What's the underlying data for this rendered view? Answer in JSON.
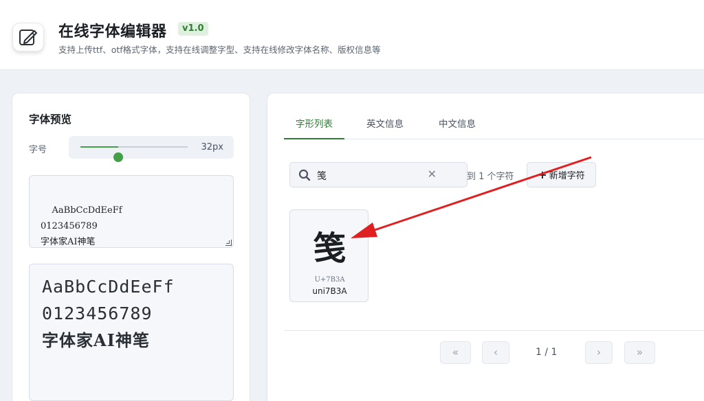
{
  "header": {
    "title": "在线字体编辑器",
    "version": "v1.0",
    "subtitle": "支持上传ttf、otf格式字体，支持在线调整字型、支持在线修改字体名称、版权信息等"
  },
  "preview": {
    "title": "字体预览",
    "size_label": "字号",
    "size_value": "32px",
    "size_fraction": 0.35,
    "sample_text": "AaBbCcDdEeFf\n0123456789\n字体家AI神笔",
    "rendered_lines": [
      "AaBbCcDdEeFf",
      "0123456789",
      "字体家AI神笔"
    ]
  },
  "tabs": [
    {
      "label": "字形列表",
      "active": true
    },
    {
      "label": "英文信息",
      "active": false
    },
    {
      "label": "中文信息",
      "active": false
    }
  ],
  "search": {
    "value": "笺",
    "result_text": "到 1 个字符",
    "search_icon": "search-icon",
    "clear_icon": "close-icon"
  },
  "add_button": {
    "label": "新增字符",
    "icon": "plus-icon"
  },
  "glyphs": [
    {
      "char": "笺",
      "code": "U+7B3A",
      "name": "uni7B3A"
    }
  ],
  "pagination": {
    "first": "«",
    "prev": "‹",
    "page": "1 / 1",
    "next": "›",
    "last": "»"
  },
  "colors": {
    "accent": "#2f7d32",
    "slider": "#43a047",
    "annotation_arrow": "#e02020"
  }
}
